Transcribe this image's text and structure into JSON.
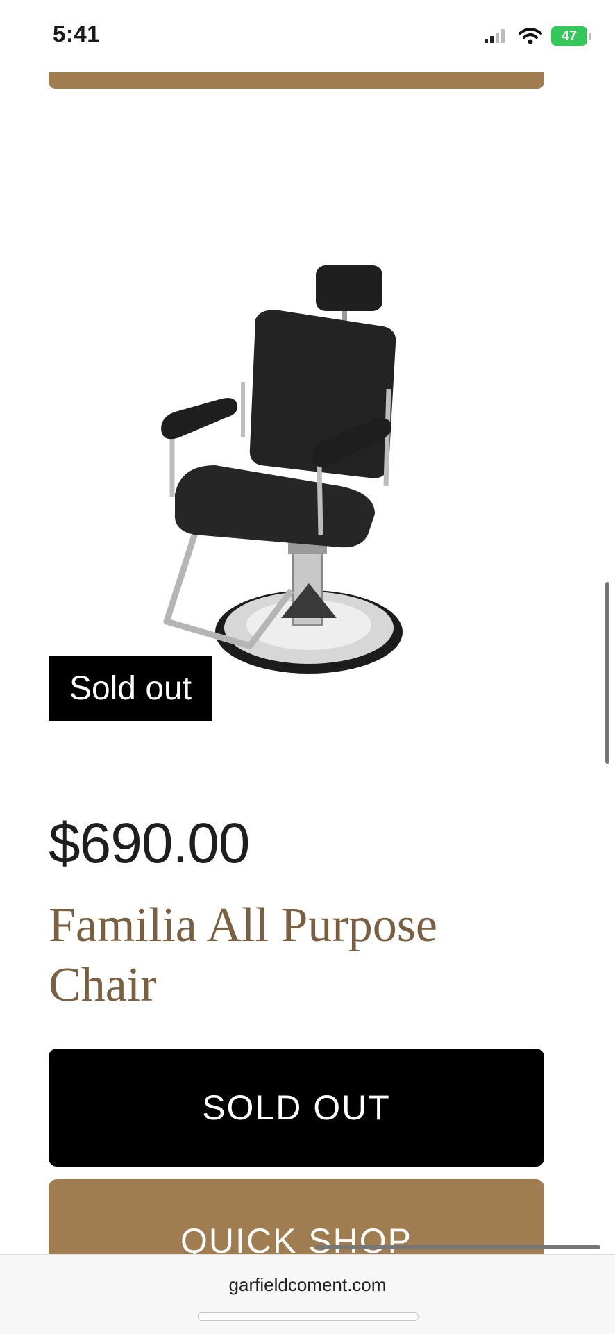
{
  "status_bar": {
    "time": "5:41",
    "battery_level": "47"
  },
  "product": {
    "badge": "Sold out",
    "price": "$690.00",
    "name": "Familia All Purpose Chair",
    "image_alt_icon": "salon-chair-image"
  },
  "actions": {
    "sold_out_label": "SOLD OUT",
    "quick_shop_label": "QUICK SHOP"
  },
  "browser": {
    "url": "garfieldcoment.com"
  },
  "colors": {
    "accent": "#a07d50",
    "name_text": "#7a6040",
    "primary_button": "#000000",
    "battery": "#34c759"
  }
}
